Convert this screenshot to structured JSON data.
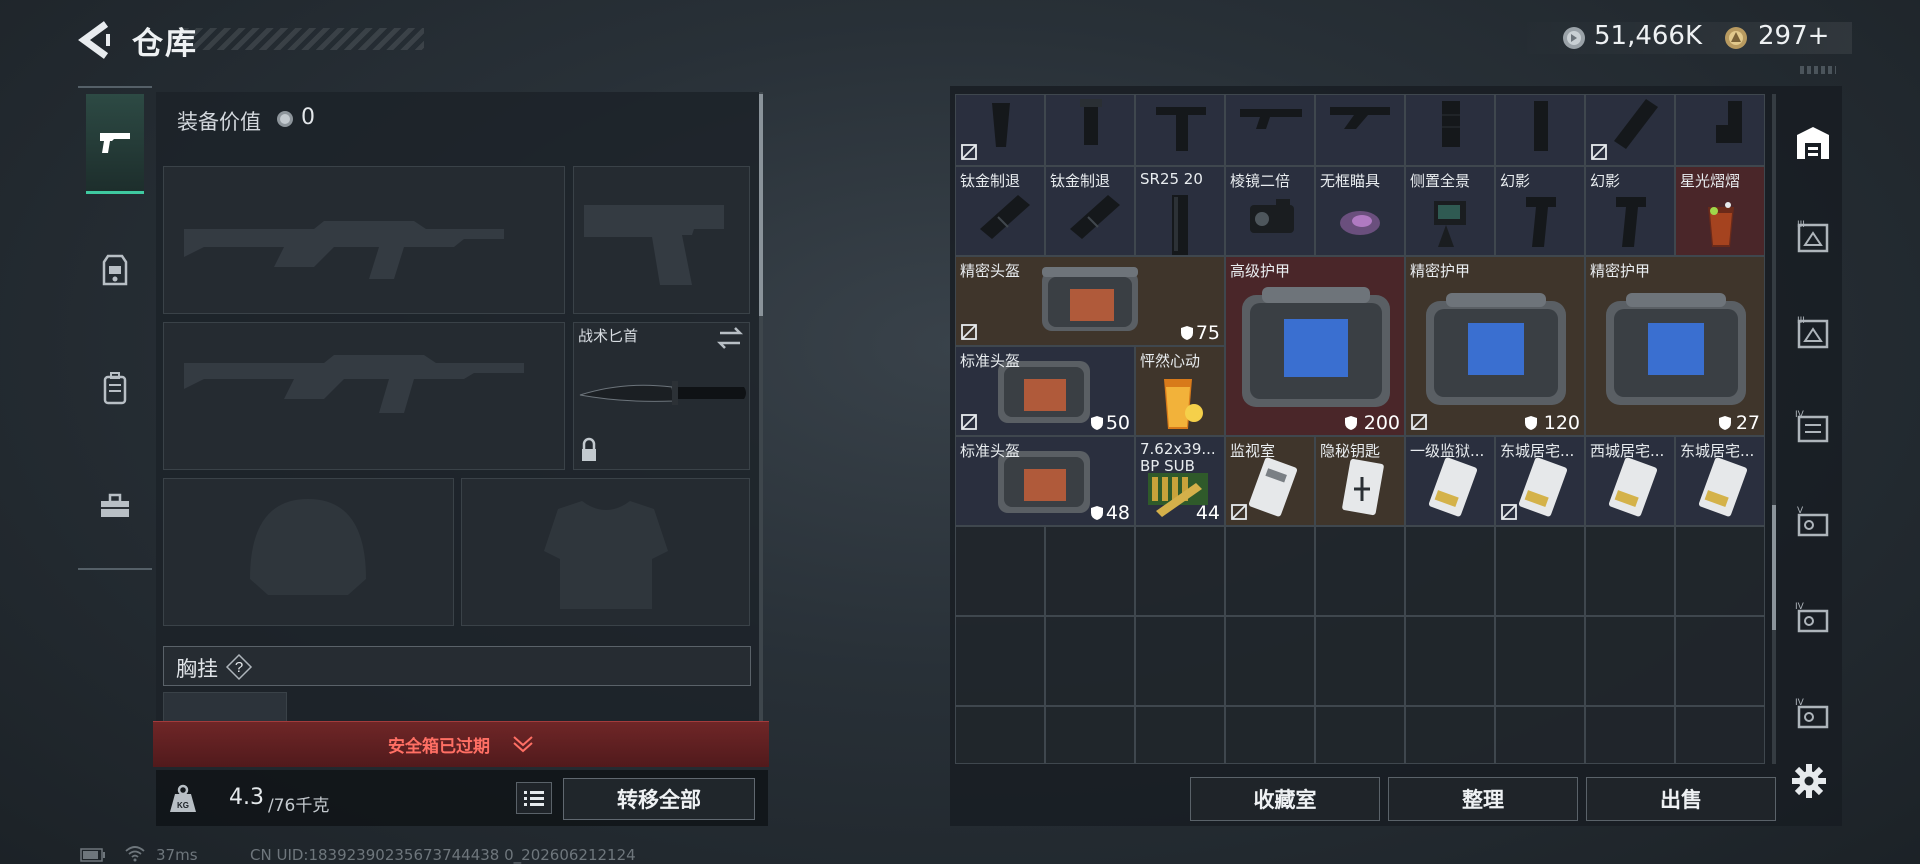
{
  "header": {
    "title": "仓库"
  },
  "currency": {
    "silver": "51,466K",
    "gold": "297+"
  },
  "loadout": {
    "equip_value_label": "装备价值",
    "equip_value": "0",
    "melee_label": "战术匕首",
    "chest_rig_label": "胸挂",
    "chest_rig_help": "?"
  },
  "safebox": {
    "expired_label": "安全箱已过期"
  },
  "weight": {
    "current": "4.3",
    "max": "/76千克"
  },
  "buttons": {
    "transfer_all": "转移全部",
    "collection": "收藏室",
    "organize": "整理",
    "sell": "出售"
  },
  "status": {
    "ping": "37ms",
    "uid": "CN UID:18392390235673744438 0_202606212124"
  },
  "storage": {
    "row0": [
      "",
      "",
      "",
      "",
      "",
      "",
      "",
      "",
      ""
    ],
    "row1": [
      "钛金制退",
      "钛金制退",
      "SR25 20",
      "棱镜二倍",
      "无框瞄具",
      "侧置全景",
      "幻影",
      "幻影",
      "星光熠熠"
    ],
    "items": {
      "helmet_precise": {
        "label": "精密头盔",
        "value": "75"
      },
      "armor_advanced": {
        "label": "高级护甲",
        "value": "200"
      },
      "armor_precise_1": {
        "label": "精密护甲",
        "value": "120"
      },
      "armor_precise_2": {
        "label": "精密护甲",
        "value": "27"
      },
      "helmet_standard_1": {
        "label": "标准头盔",
        "value": "50"
      },
      "drink": {
        "label": "怦然心动"
      },
      "helmet_standard_2": {
        "label": "标准头盔",
        "value": "48"
      },
      "ammo": {
        "label": "7.62x39...",
        "sub": "BP SUB",
        "value": "44"
      },
      "card_1": {
        "label": "监视室"
      },
      "card_2": {
        "label": "隐秘钥匙"
      },
      "card_3": {
        "label": "一级监狱..."
      },
      "card_4": {
        "label": "东城居宅..."
      },
      "card_5": {
        "label": "西城居宅..."
      },
      "card_6": {
        "label": "东城居宅..."
      }
    }
  },
  "right_tabs": [
    "",
    "III",
    "III",
    "IV",
    "V",
    "IV",
    "IV"
  ],
  "colors": {
    "accent": "#3fc9a0",
    "alert": "#ff6f64",
    "rarity_purple": "#2c2838",
    "rarity_gold": "#3f352b",
    "rarity_red": "#4a2629"
  }
}
